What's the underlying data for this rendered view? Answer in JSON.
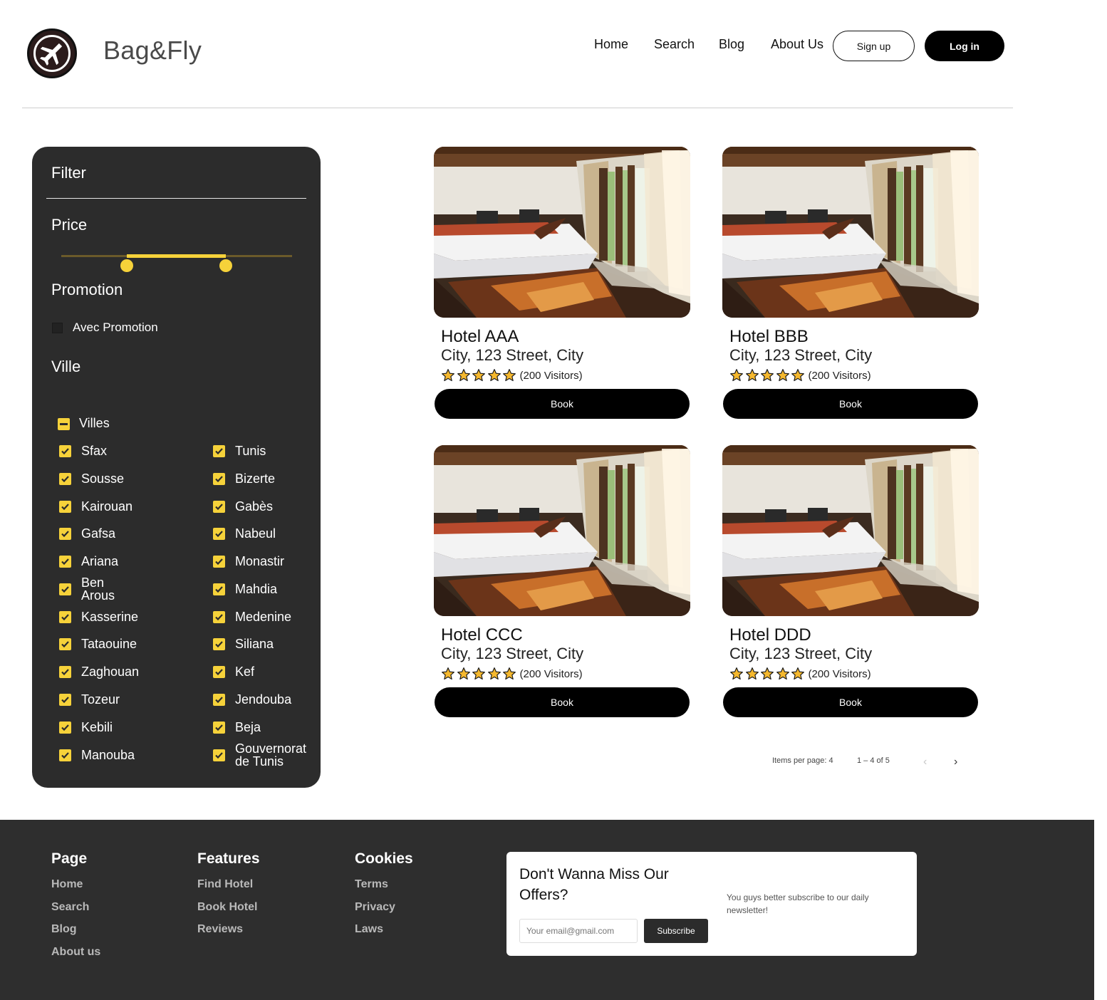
{
  "app": {
    "brand": "Bag&Fly",
    "logo_icon": "airplane-icon"
  },
  "nav": {
    "home": "Home",
    "search": "Search",
    "blog": "Blog",
    "about": "About Us",
    "signup": "Sign up",
    "login": "Log in"
  },
  "filter": {
    "title": "Filter",
    "price_label": "Price",
    "price_range_fraction": [
      0.28,
      0.71
    ],
    "promotion_label": "Promotion",
    "promotion_option": "Avec Promotion",
    "promotion_checked": false,
    "ville_label": "Ville",
    "villes_parent": "Villes",
    "villes_parent_state": "indeterminate",
    "cities_left": [
      "Sfax",
      "Sousse",
      "Kairouan",
      "Gafsa",
      "Ariana",
      "Ben Arous",
      "Kasserine",
      "Tataouine",
      "Zaghouan",
      "Tozeur",
      "Kebili",
      "Manouba"
    ],
    "cities_right": [
      "Tunis",
      "Bizerte",
      "Gabès",
      "Nabeul",
      "Monastir",
      "Mahdia",
      "Medenine",
      "Siliana",
      "Kef",
      "Jendouba",
      "Beja",
      "Gouvernorat de Tunis"
    ],
    "accent_color": "#f6d23a"
  },
  "hotels": [
    {
      "name": "Hotel AAA",
      "address": "City, 123 Street, City",
      "rating": 5,
      "visitors": "(200 Visitors)",
      "book": "Book"
    },
    {
      "name": "Hotel BBB",
      "address": "City, 123 Street, City",
      "rating": 5,
      "visitors": "(200 Visitors)",
      "book": "Book"
    },
    {
      "name": "Hotel CCC",
      "address": "City, 123 Street, City",
      "rating": 5,
      "visitors": "(200 Visitors)",
      "book": "Book"
    },
    {
      "name": "Hotel DDD",
      "address": "City, 123 Street, City",
      "rating": 5,
      "visitors": "(200 Visitors)",
      "book": "Book"
    }
  ],
  "paginator": {
    "items_per_page": "Items per page: 4",
    "range": "1 – 4 of 5"
  },
  "footer": {
    "page": {
      "title": "Page",
      "links": [
        "Home",
        "Search",
        "Blog",
        "About us"
      ]
    },
    "features": {
      "title": "Features",
      "links": [
        "Find Hotel",
        "Book Hotel",
        "Reviews"
      ]
    },
    "cookies": {
      "title": "Cookies",
      "links": [
        "Terms",
        "Privacy",
        "Laws"
      ]
    },
    "newsletter": {
      "title": "Don't Wanna Miss Our Offers?",
      "text": "You guys better subscribe to our daily newsletter!",
      "placeholder": "Your email@gmail.com",
      "button": "Subscribe"
    }
  }
}
